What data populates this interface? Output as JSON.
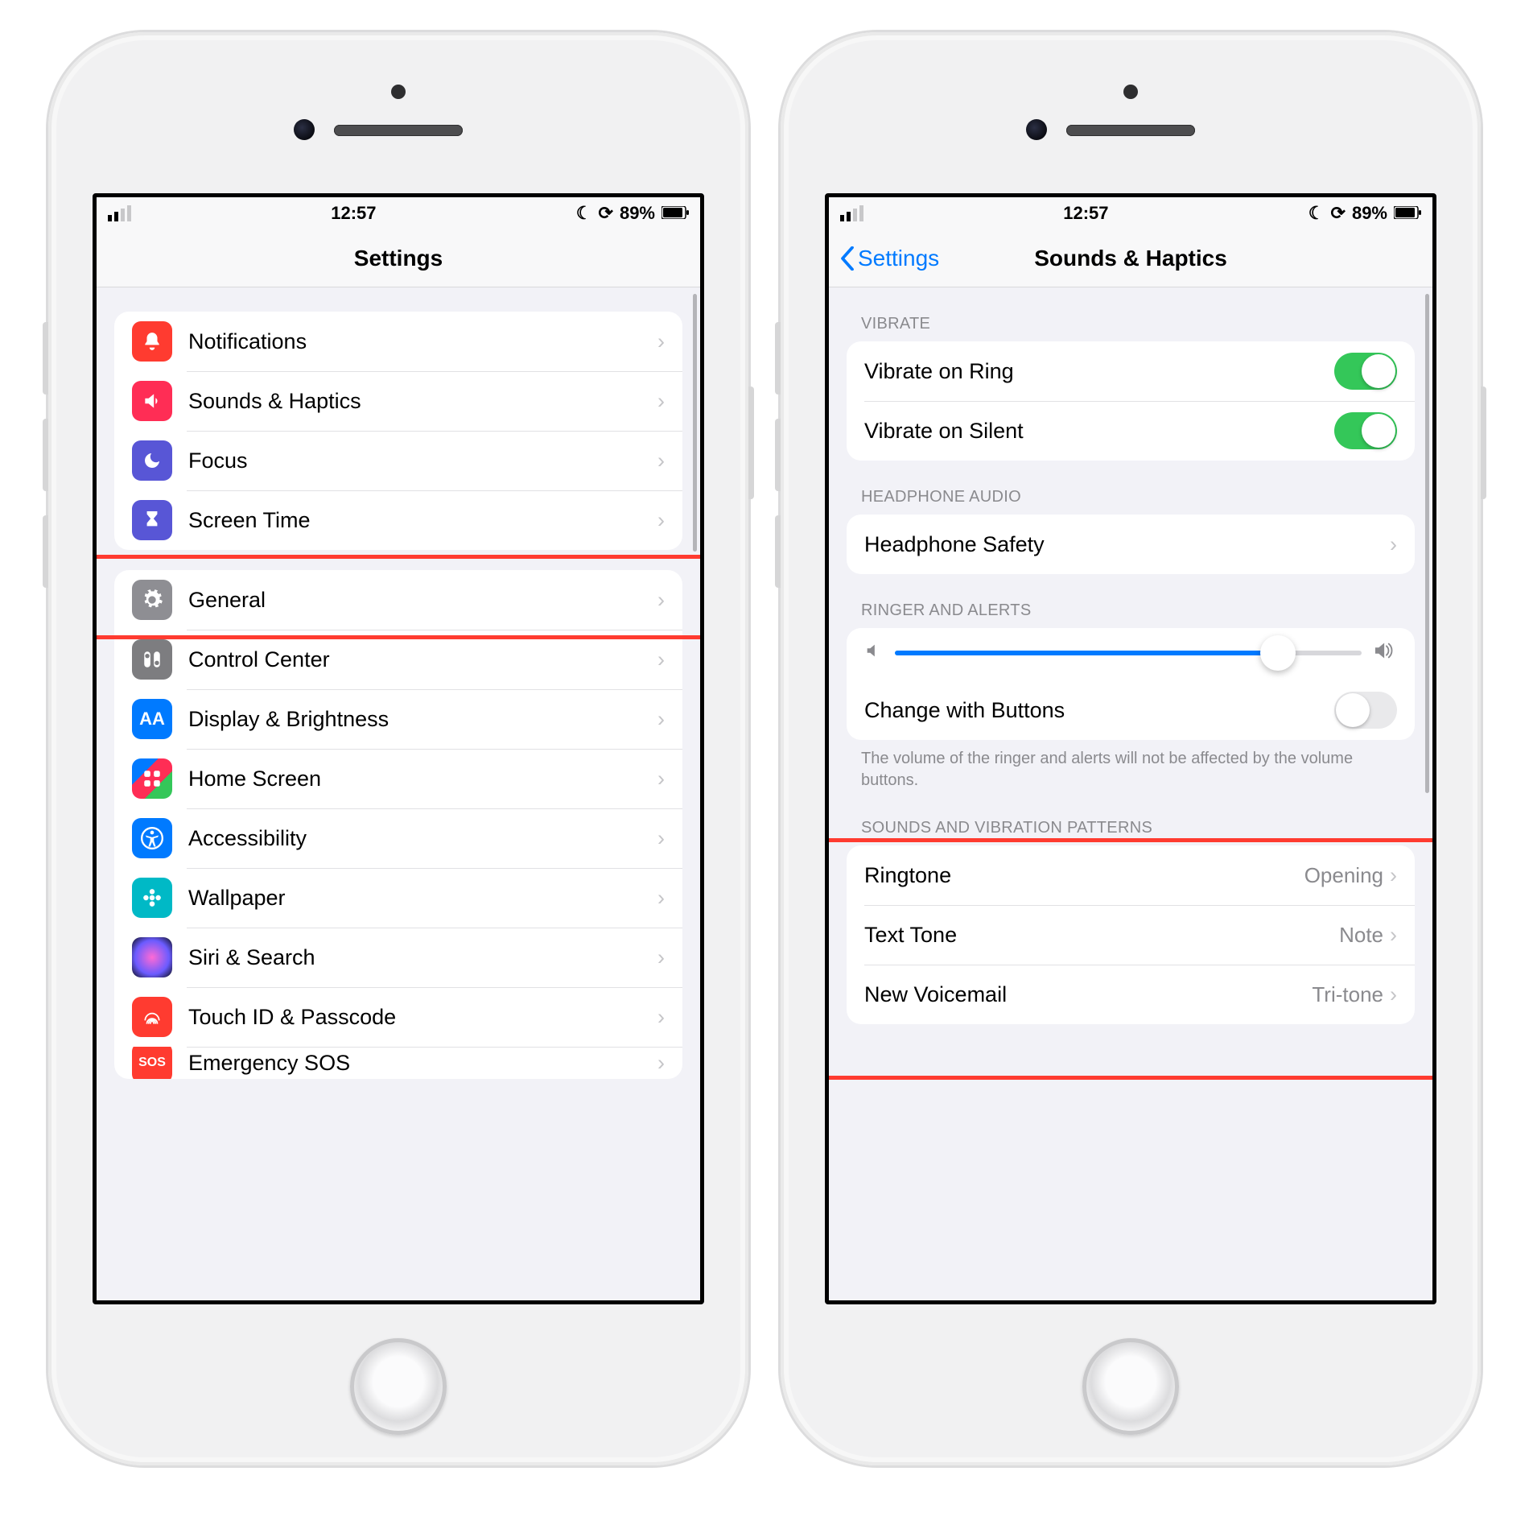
{
  "status": {
    "time": "12:57",
    "battery": "89%"
  },
  "phone1": {
    "title": "Settings",
    "rows1": [
      {
        "label": "Notifications"
      },
      {
        "label": "Sounds & Haptics"
      },
      {
        "label": "Focus"
      },
      {
        "label": "Screen Time"
      }
    ],
    "rows2": [
      {
        "label": "General"
      },
      {
        "label": "Control Center"
      },
      {
        "label": "Display & Brightness"
      },
      {
        "label": "Home Screen"
      },
      {
        "label": "Accessibility"
      },
      {
        "label": "Wallpaper"
      },
      {
        "label": "Siri & Search"
      },
      {
        "label": "Touch ID & Passcode"
      },
      {
        "label": "Emergency SOS"
      }
    ]
  },
  "phone2": {
    "back": "Settings",
    "title": "Sounds & Haptics",
    "sec_vibrate": "Vibrate",
    "vibrate": [
      {
        "label": "Vibrate on Ring",
        "on": true
      },
      {
        "label": "Vibrate on Silent",
        "on": true
      }
    ],
    "sec_headphone": "Headphone Audio",
    "headphone": {
      "label": "Headphone Safety"
    },
    "sec_ringer": "Ringer and Alerts",
    "slider_pct": 82,
    "change_buttons": {
      "label": "Change with Buttons",
      "on": false
    },
    "ringer_foot": "The volume of the ringer and alerts will not be affected by the volume buttons.",
    "sec_patterns": "Sounds and Vibration Patterns",
    "patterns": [
      {
        "label": "Ringtone",
        "value": "Opening"
      },
      {
        "label": "Text Tone",
        "value": "Note"
      },
      {
        "label": "New Voicemail",
        "value": "Tri-tone"
      }
    ]
  }
}
